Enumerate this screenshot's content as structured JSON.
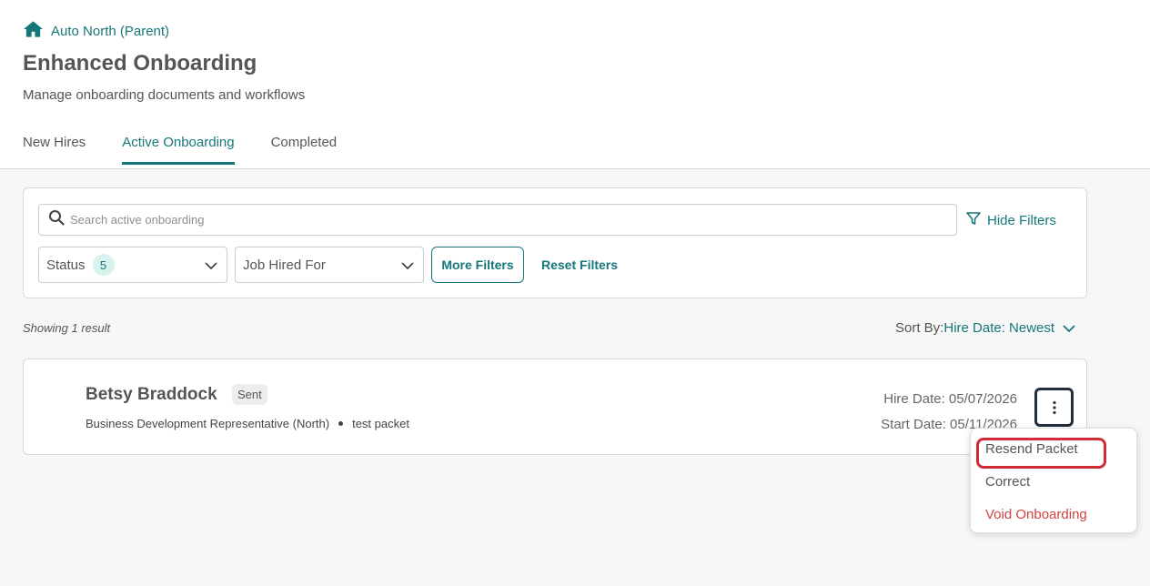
{
  "breadcrumb": {
    "label": "Auto North (Parent)",
    "icon": "home-icon"
  },
  "page": {
    "title": "Enhanced Onboarding",
    "subtitle": "Manage onboarding documents and workflows"
  },
  "tabs": [
    {
      "label": "New Hires",
      "active": false
    },
    {
      "label": "Active Onboarding",
      "active": true
    },
    {
      "label": "Completed",
      "active": false
    }
  ],
  "filters": {
    "search_placeholder": "Search active onboarding",
    "hide_filters_label": "Hide Filters",
    "status_label": "Status",
    "status_count": "5",
    "job_label": "Job Hired For",
    "more_filters_label": "More Filters",
    "reset_filters_label": "Reset Filters"
  },
  "results": {
    "count_text": "Showing 1 result",
    "sort_label": "Sort By:",
    "sort_value": "Hire Date: Newest"
  },
  "record": {
    "name": "Betsy Braddock",
    "status": "Sent",
    "job": "Business Development Representative (North)",
    "packet": "test packet",
    "hire_date": "Hire Date: 05/07/2026",
    "start_date": "Start Date: 05/11/2026"
  },
  "menu": {
    "items": [
      {
        "label": "Resend Packet"
      },
      {
        "label": "Correct"
      },
      {
        "label": "Void Onboarding"
      }
    ]
  },
  "colors": {
    "accent": "#16777a",
    "danger": "#d14343",
    "highlight": "#d12b36"
  }
}
